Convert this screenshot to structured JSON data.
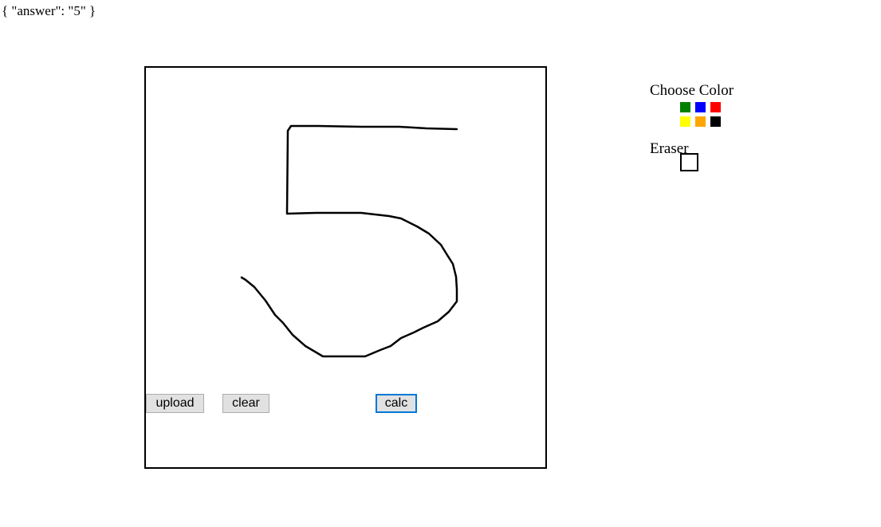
{
  "answer_text": "{ \"answer\": \"5\" }",
  "drawing": {
    "stroke_color": "#000000",
    "depicted_digit": "5"
  },
  "buttons": {
    "upload": "upload",
    "clear": "clear",
    "calc": "calc"
  },
  "palette": {
    "title": "Choose Color",
    "colors": [
      {
        "name": "green",
        "hex": "#008000"
      },
      {
        "name": "blue",
        "hex": "#0000ff"
      },
      {
        "name": "red",
        "hex": "#ff0000"
      },
      {
        "name": "yellow",
        "hex": "#ffff00"
      },
      {
        "name": "orange",
        "hex": "#ffa500"
      },
      {
        "name": "black",
        "hex": "#000000"
      }
    ],
    "eraser_label": "Eraser"
  }
}
